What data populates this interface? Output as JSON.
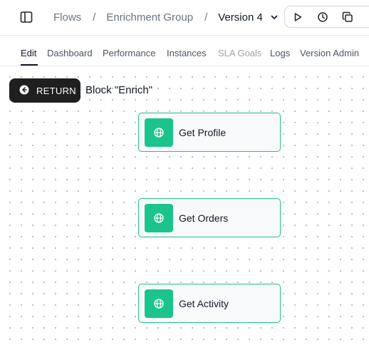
{
  "header": {
    "breadcrumb": [
      "Flows",
      "Enrichment Group"
    ],
    "separator": "/",
    "current": "Version 4"
  },
  "icons": {
    "sidebar_toggle": "sidebar-toggle-icon",
    "chevron": "chevron-down-icon",
    "run": "play-icon",
    "history": "clock-icon",
    "duplicate": "copy-icon",
    "return": "arrow-left-circle-icon",
    "node": "globe-icon"
  },
  "tabs": [
    {
      "label": "Edit",
      "state": "active"
    },
    {
      "label": "Dashboard",
      "state": "normal"
    },
    {
      "label": "Performance",
      "state": "normal"
    },
    {
      "label": "Instances",
      "state": "normal"
    },
    {
      "label": "SLA Goals",
      "state": "disabled"
    },
    {
      "label": "Logs",
      "state": "normal"
    },
    {
      "label": "Version Admin",
      "state": "normal"
    }
  ],
  "canvas": {
    "return_label": "RETURN",
    "block_title": "Block \"Enrich\"",
    "nodes": [
      {
        "label": "Get Profile"
      },
      {
        "label": "Get Orders"
      },
      {
        "label": "Get Activity"
      }
    ]
  },
  "colors": {
    "node_accent": "#1cc48d",
    "node_border": "#21c08b",
    "return_bg": "#1f1f1f"
  }
}
